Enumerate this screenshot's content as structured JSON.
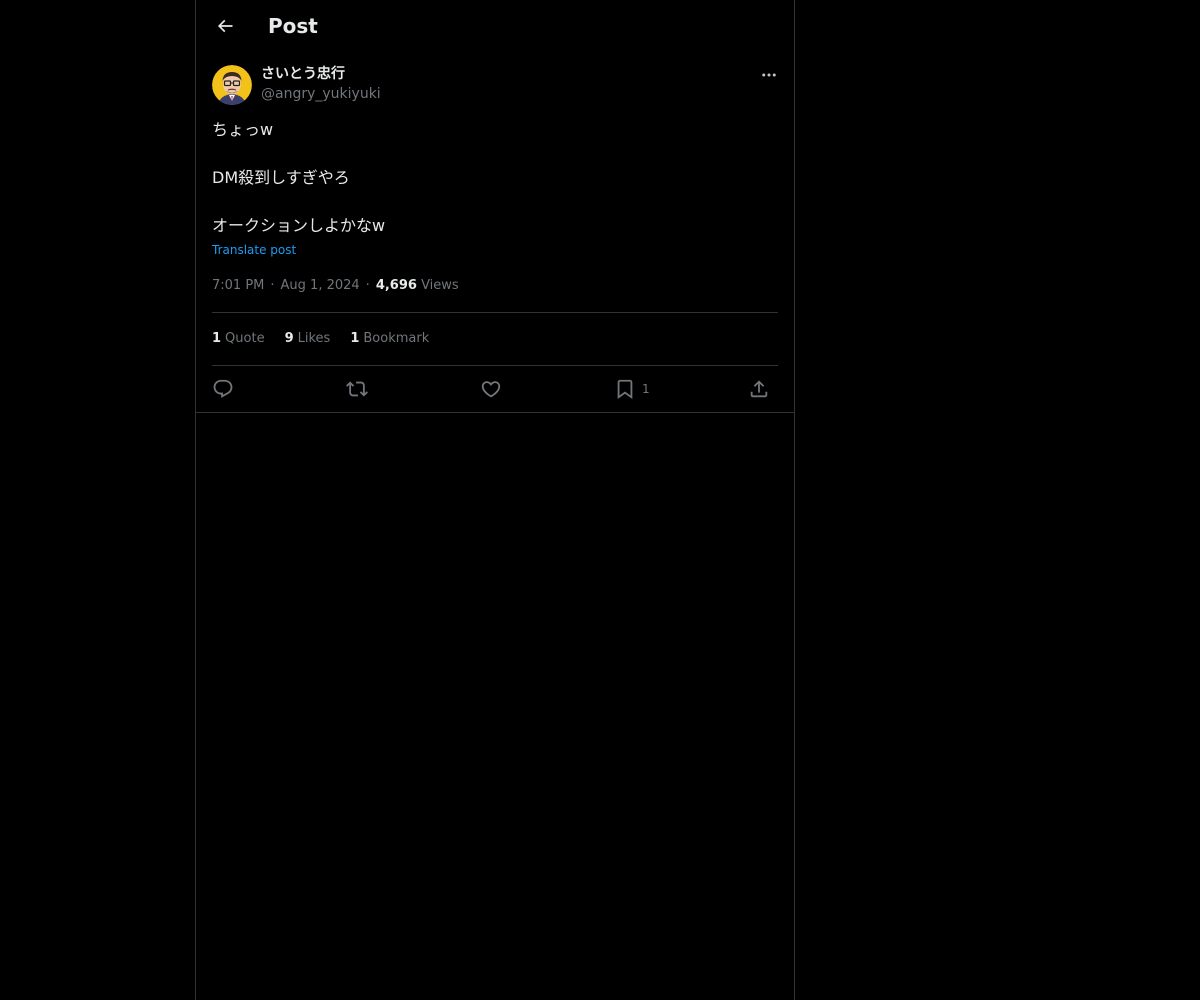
{
  "header": {
    "back_icon": "arrow-left-icon",
    "title": "Post"
  },
  "post": {
    "author": {
      "display_name": "さいとう忠行",
      "handle": "@angry_yukiyuki",
      "avatar": "cartoon-avatar-with-glasses"
    },
    "text_lines": [
      "ちょっw",
      "DM殺到しすぎやろ",
      "オークションしよかなw"
    ],
    "translate_label": "Translate post",
    "time": "7:01 PM",
    "date": "Aug 1, 2024",
    "views_count": "4,696",
    "views_label": "Views",
    "separator": "·",
    "stats": {
      "quotes": {
        "count": "1",
        "label": "Quote"
      },
      "likes": {
        "count": "9",
        "label": "Likes"
      },
      "bookmarks": {
        "count": "1",
        "label": "Bookmark"
      }
    },
    "actions": {
      "reply_icon": "reply-icon",
      "repost_icon": "repost-icon",
      "like_icon": "heart-icon",
      "bookmark_icon": "bookmark-icon",
      "bookmark_count": "1",
      "share_icon": "share-icon"
    }
  },
  "colors": {
    "background": "#000000",
    "text": "#e7e9ea",
    "muted": "#71767b",
    "link": "#1d9bf0",
    "border": "#2f3336"
  }
}
